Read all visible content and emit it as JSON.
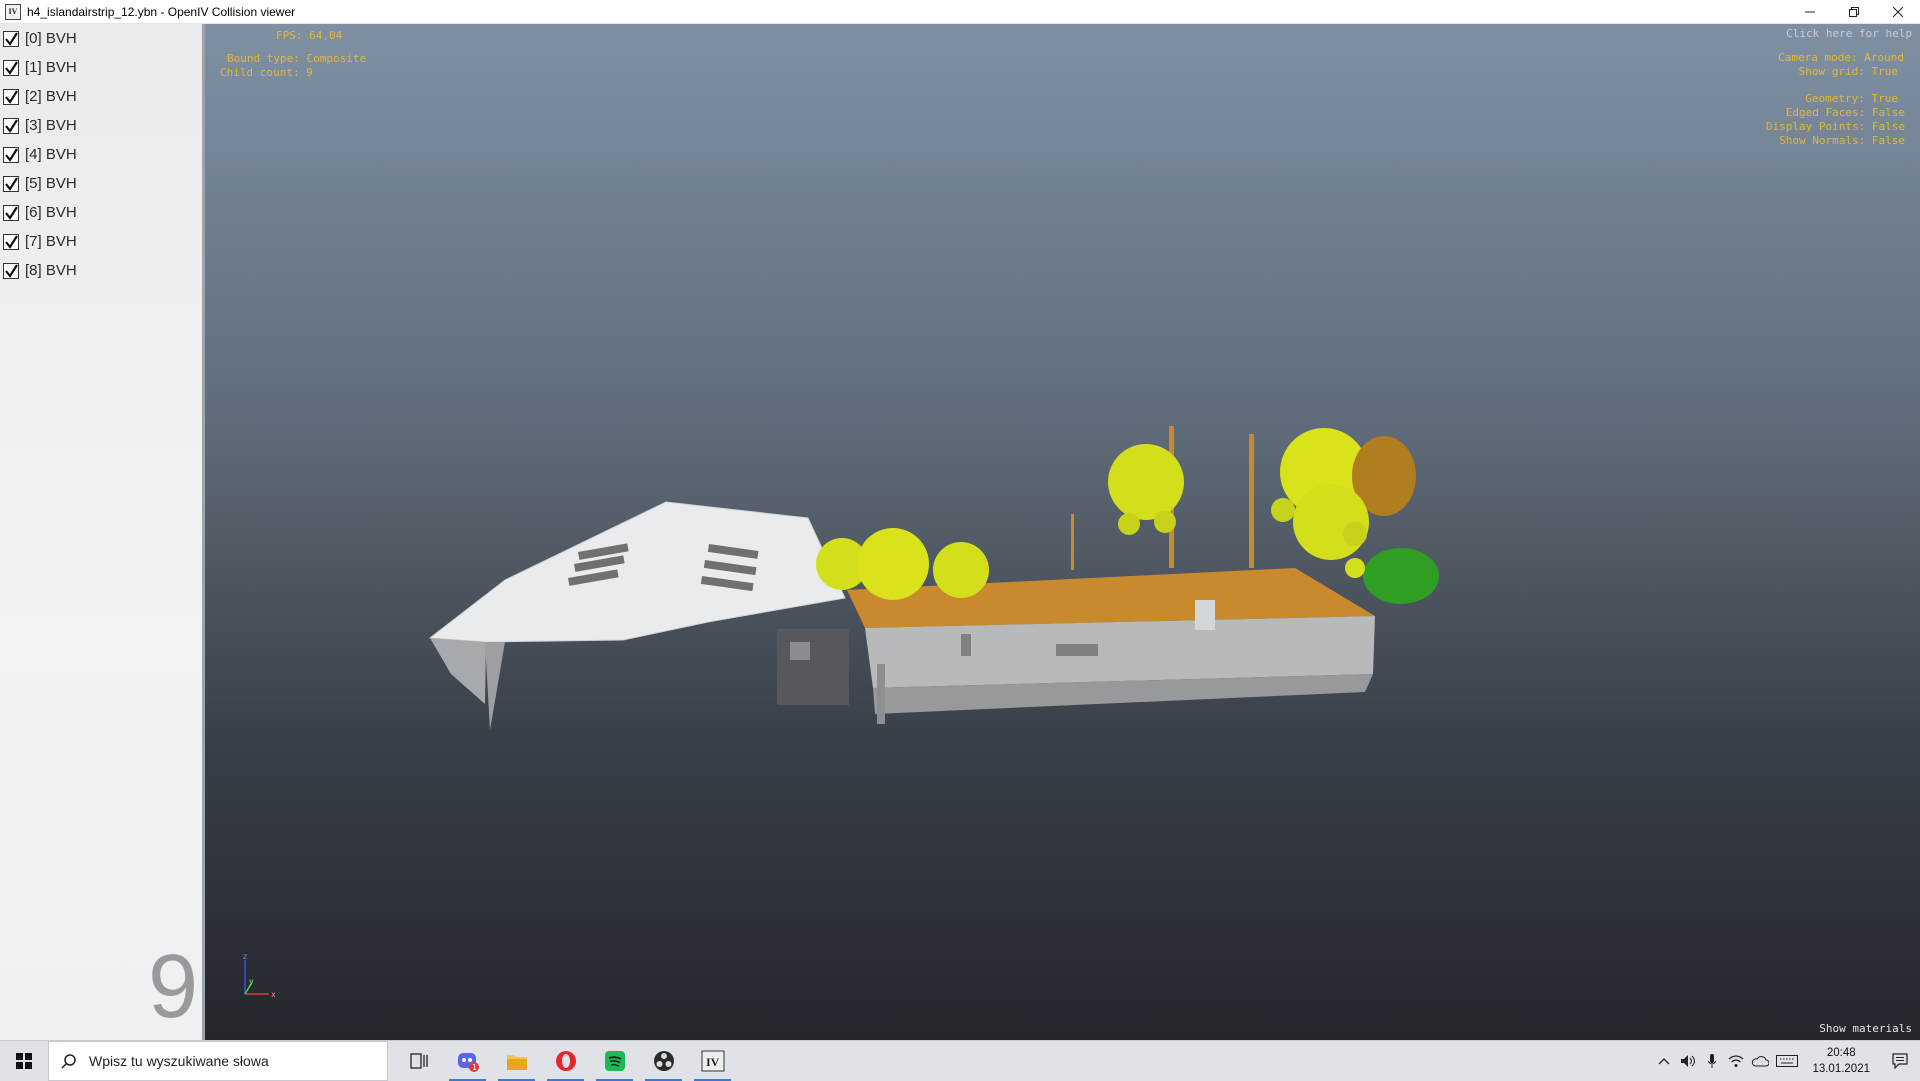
{
  "window": {
    "title": "h4_islandairstrip_12.ybn - OpenIV Collision viewer",
    "icon_label": "IV",
    "controls": [
      "minimize-icon",
      "restore-icon",
      "close-icon"
    ]
  },
  "sidebar": {
    "items": [
      {
        "label": "[0] BVH",
        "checked": true
      },
      {
        "label": "[1] BVH",
        "checked": true
      },
      {
        "label": "[2] BVH",
        "checked": true
      },
      {
        "label": "[3] BVH",
        "checked": true
      },
      {
        "label": "[4] BVH",
        "checked": true
      },
      {
        "label": "[5] BVH",
        "checked": true
      },
      {
        "label": "[6] BVH",
        "checked": true
      },
      {
        "label": "[7] BVH",
        "checked": true
      },
      {
        "label": "[8] BVH",
        "checked": true
      }
    ],
    "count": "9"
  },
  "viewport": {
    "fps": "FPS: 64,04",
    "bound_type": "Bound type: Composite",
    "child_count": "Child count: 9",
    "help": "Click here for help",
    "camera_mode": "Camera mode: Around",
    "show_grid": "Show grid: True",
    "geometry": "Geometry: True",
    "edged_faces": "Edged Faces: False",
    "display_points": "Display Points: False",
    "show_normals": "Show Normals: False",
    "show_materials": "Show materials",
    "axis_labels": {
      "z": "z",
      "y": "y",
      "x": "x"
    },
    "colors": {
      "overlay_text": "#e0b93a",
      "tree_yellow": "#d9e21a",
      "roof_orange": "#c98a2e",
      "building_gray": "#b5b7b9",
      "bush_green": "#2f9e22"
    }
  },
  "taskbar": {
    "search_placeholder": "Wpisz tu wyszukiwane słowa",
    "apps": [
      {
        "name": "task-view-icon",
        "active": false
      },
      {
        "name": "discord-icon",
        "active": true,
        "badge": "1"
      },
      {
        "name": "file-explorer-icon",
        "active": true
      },
      {
        "name": "opera-icon",
        "active": true
      },
      {
        "name": "spotify-icon",
        "active": true
      },
      {
        "name": "obs-icon",
        "active": true
      },
      {
        "name": "openiv-icon",
        "active": true
      }
    ],
    "time": "20:48",
    "date": "13.01.2021"
  }
}
